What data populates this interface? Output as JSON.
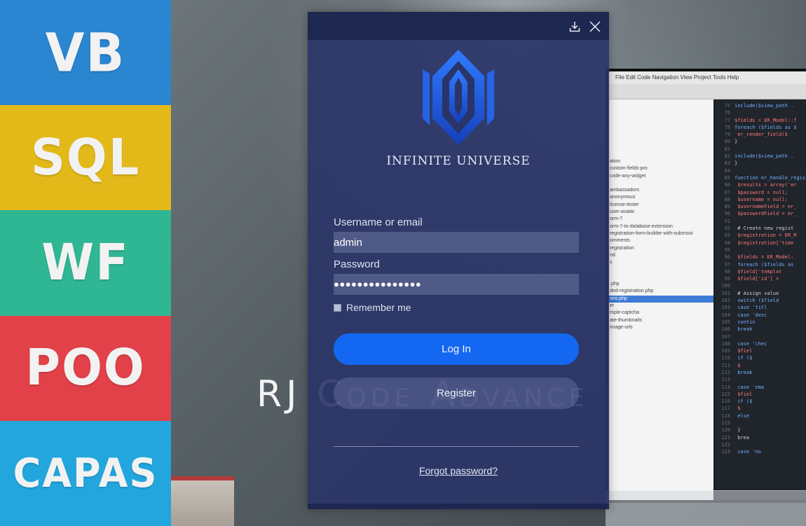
{
  "sidebar": {
    "tiles": [
      {
        "label": "VB",
        "color": "#2a86d1"
      },
      {
        "label": "SQL",
        "color": "#e3b91a"
      },
      {
        "label": "WF",
        "color": "#2fb794"
      },
      {
        "label": "POO",
        "color": "#e24149"
      },
      {
        "label": "CAPAS",
        "color": "#22a6dd"
      }
    ]
  },
  "background": {
    "brand_text": "RJ Code Advance",
    "ide_menu": "File  Edit  Code  Navigation  View  Project  Tools  Help",
    "project_files": [
      "ation",
      "custom-fields-pro",
      "code-any-widget",
      "",
      "ambassadors",
      "anonymous",
      "license-tester",
      "user-avatar",
      "orm-7",
      "orm-7-to-database-extension",
      "registration-form-builder-with-submissi",
      "omments",
      "registration",
      "nd",
      "s",
      "",
      "",
      ".php",
      "ded-registration.php",
      "ons.php",
      "er",
      "mple-captcha",
      "ate-thumbnails",
      "image-urls"
    ],
    "code_lines": [
      {
        "n": "75",
        "t": "include($view_path ."
      },
      {
        "n": "76",
        "t": ""
      },
      {
        "n": "77",
        "t": "$fields = ER_Model::f"
      },
      {
        "n": "78",
        "t": "foreach ($fields as $"
      },
      {
        "n": "79",
        "t": "  er_render_field($"
      },
      {
        "n": "80",
        "t": "}"
      },
      {
        "n": "81",
        "t": ""
      },
      {
        "n": "82",
        "t": "include($view_path ."
      },
      {
        "n": "83",
        "t": "}"
      },
      {
        "n": "84",
        "t": ""
      },
      {
        "n": "85",
        "t": "function er_handle_regis"
      },
      {
        "n": "86",
        "t": "  $results = array('er"
      },
      {
        "n": "87",
        "t": "  $password = null;"
      },
      {
        "n": "88",
        "t": "  $username = null;"
      },
      {
        "n": "89",
        "t": "  $usernameField = er_"
      },
      {
        "n": "90",
        "t": "  $passwordField = er_"
      },
      {
        "n": "91",
        "t": ""
      },
      {
        "n": "92",
        "t": "  # Create new regist"
      },
      {
        "n": "93",
        "t": "  $registration = ER_M"
      },
      {
        "n": "94",
        "t": "  $registration['time"
      },
      {
        "n": "95",
        "t": ""
      },
      {
        "n": "96",
        "t": "  $fields = ER_Model:"
      },
      {
        "n": "97",
        "t": "  foreach ($fields as"
      },
      {
        "n": "98",
        "t": "    $field['templat"
      },
      {
        "n": "99",
        "t": "    $field['id'] ="
      },
      {
        "n": "100",
        "t": ""
      },
      {
        "n": "101",
        "t": "    # Assign value"
      },
      {
        "n": "102",
        "t": "    switch ($field"
      },
      {
        "n": "103",
        "t": "      case 'titl"
      },
      {
        "n": "104",
        "t": "      case 'desc"
      },
      {
        "n": "105",
        "t": "        contin"
      },
      {
        "n": "106",
        "t": "        break"
      },
      {
        "n": "107",
        "t": ""
      },
      {
        "n": "108",
        "t": "      case 'chec"
      },
      {
        "n": "109",
        "t": "        $fiel"
      },
      {
        "n": "110",
        "t": "        if ($"
      },
      {
        "n": "111",
        "t": "          $"
      },
      {
        "n": "112",
        "t": "        break"
      },
      {
        "n": "113",
        "t": ""
      },
      {
        "n": "114",
        "t": "      case 'ema"
      },
      {
        "n": "115",
        "t": "        $fiel"
      },
      {
        "n": "116",
        "t": "        if ($"
      },
      {
        "n": "117",
        "t": "          $"
      },
      {
        "n": "118",
        "t": "        else"
      },
      {
        "n": "119",
        "t": ""
      },
      {
        "n": "120",
        "t": "        }"
      },
      {
        "n": "121",
        "t": "        brea"
      },
      {
        "n": "122",
        "t": ""
      },
      {
        "n": "123",
        "t": "      case 'no"
      }
    ]
  },
  "dialog": {
    "minimize_icon": "download-arrow-icon",
    "close_icon": "close-x-icon",
    "logo_title": "INFINITE UNIVERSE",
    "username_label": "Username or email",
    "username_value": "admin",
    "password_label": "Password",
    "password_masked": "●●●●●●●●●●●●●●●",
    "remember_label": "Remember me",
    "login_label": "Log In",
    "register_label": "Register",
    "forgot_label": "Forgot password?",
    "colors": {
      "login_button": "#1467f0",
      "dialog_bg": "#293468",
      "logo_blue": "#1e5ce0"
    }
  }
}
